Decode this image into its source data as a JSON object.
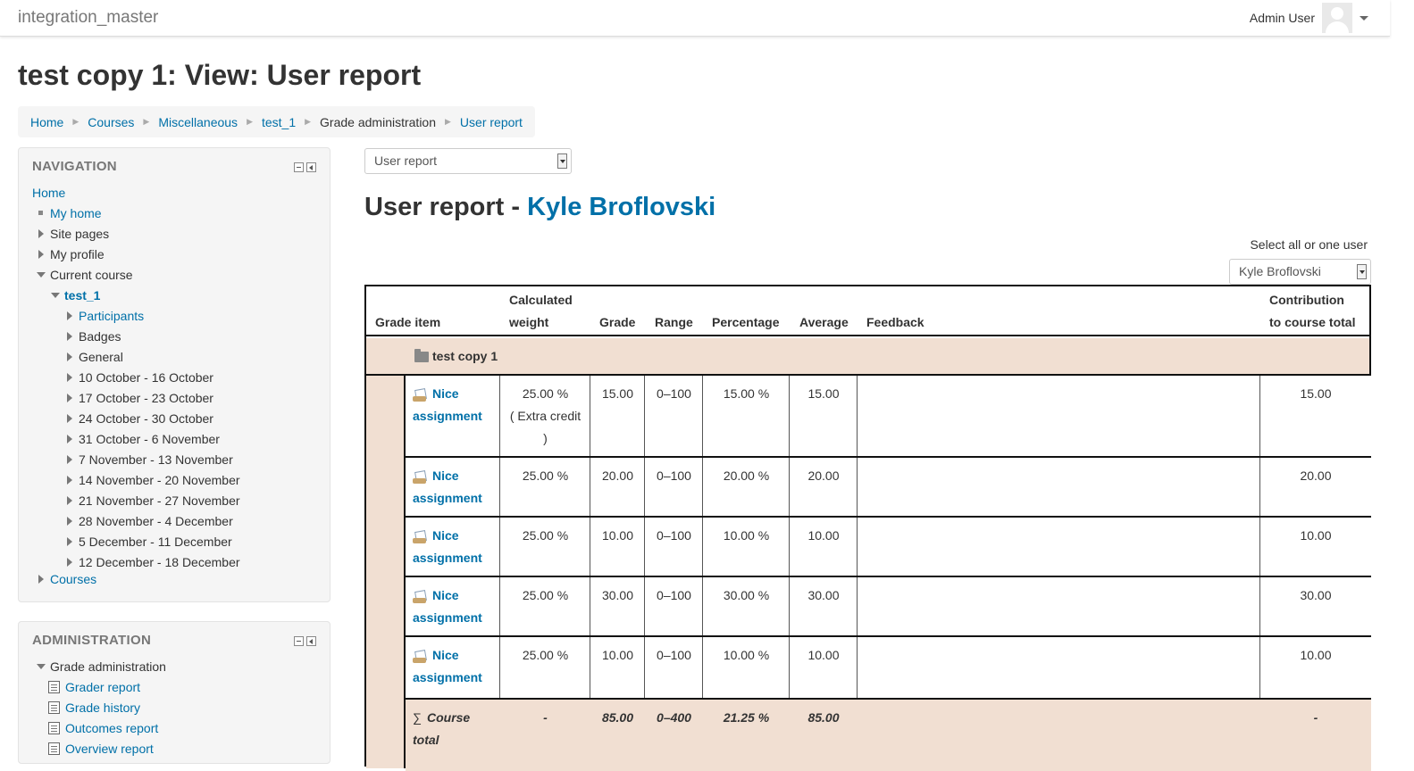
{
  "topbar": {
    "brand": "integration_master",
    "user": "Admin User"
  },
  "page": {
    "title": "test copy 1: View: User report"
  },
  "breadcrumb": [
    "Home",
    "Courses",
    "Miscellaneous",
    "test_1",
    "Grade administration",
    "User report"
  ],
  "navigation": {
    "title": "NAVIGATION",
    "home": "Home",
    "my_home": "My home",
    "site_pages": "Site pages",
    "my_profile": "My profile",
    "current_course": "Current course",
    "course": "test_1",
    "participants": "Participants",
    "badges": "Badges",
    "general": "General",
    "weeks": [
      "10 October - 16 October",
      "17 October - 23 October",
      "24 October - 30 October",
      "31 October - 6 November",
      "7 November - 13 November",
      "14 November - 20 November",
      "21 November - 27 November",
      "28 November - 4 December",
      "5 December - 11 December",
      "12 December - 18 December"
    ],
    "courses": "Courses"
  },
  "administration": {
    "title": "ADMINISTRATION",
    "grade_admin": "Grade administration",
    "items": [
      "Grader report",
      "Grade history",
      "Outcomes report",
      "Overview report"
    ]
  },
  "report": {
    "select_value": "User report",
    "heading_prefix": "User report - ",
    "user_name": "Kyle Broflovski",
    "select_label": "Select all or one user",
    "user_select_value": "Kyle Broflovski"
  },
  "table": {
    "headers": {
      "grade_item": "Grade item",
      "calc_weight_1": "Calculated",
      "calc_weight_2": "weight",
      "grade": "Grade",
      "range": "Range",
      "percentage": "Percentage",
      "average": "Average",
      "feedback": "Feedback",
      "contribution_1": "Contribution",
      "contribution_2": "to course total"
    },
    "category": "test copy 1",
    "rows": [
      {
        "name1": "Nice",
        "name2": "assignment",
        "weight1": "25.00 %",
        "weight2": "( Extra credit",
        "weight3": ")",
        "grade": "15.00",
        "range": "0–100",
        "percentage": "15.00 %",
        "average": "15.00",
        "contribution": "15.00"
      },
      {
        "name1": "Nice",
        "name2": "assignment",
        "weight1": "25.00 %",
        "grade": "20.00",
        "range": "0–100",
        "percentage": "20.00 %",
        "average": "20.00",
        "contribution": "20.00"
      },
      {
        "name1": "Nice",
        "name2": "assignment",
        "weight1": "25.00 %",
        "grade": "10.00",
        "range": "0–100",
        "percentage": "10.00 %",
        "average": "10.00",
        "contribution": "10.00"
      },
      {
        "name1": "Nice",
        "name2": "assignment",
        "weight1": "25.00 %",
        "grade": "30.00",
        "range": "0–100",
        "percentage": "30.00 %",
        "average": "30.00",
        "contribution": "30.00"
      },
      {
        "name1": "Nice",
        "name2": "assignment",
        "weight1": "25.00 %",
        "grade": "10.00",
        "range": "0–100",
        "percentage": "10.00 %",
        "average": "10.00",
        "contribution": "10.00"
      }
    ],
    "total": {
      "name1": "Course",
      "name2": "total",
      "weight": "-",
      "grade": "85.00",
      "range": "0–400",
      "percentage": "21.25 %",
      "average": "85.00",
      "contribution": "-"
    }
  }
}
